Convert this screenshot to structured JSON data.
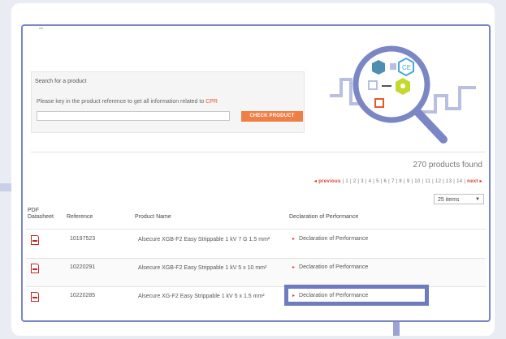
{
  "search": {
    "title": "Search for a product",
    "description": "Please key in the product reference to get all information related to",
    "description_link": "CPR",
    "input_value": "",
    "button_label": "CHECK PRODUCT"
  },
  "results": {
    "count_label": "270 products found",
    "pager": {
      "previous": "◂ previous",
      "pages": "| 1 | 2 | 3 | 4 | 5 | 6 | 7 | 8 | 9 | 10 | 11 | 12 | 13 | 14 |",
      "next": "next ▸"
    },
    "items_per_page": "25 items"
  },
  "table": {
    "headers": {
      "pdf": "PDF Datasheet",
      "reference": "Reference",
      "product_name": "Product Name",
      "dop": "Declaration of Performance"
    },
    "rows": [
      {
        "reference": "10197523",
        "product_name": "Alsecure XGB-F2 Easy Strippable 1 kV 7 G 1.5 mm²",
        "dop": "Declaration of Performance"
      },
      {
        "reference": "10220291",
        "product_name": "Alsecure XGB-F2 Easy Strippable 1 kV 5 x 10 mm²",
        "dop": "Declaration of Performance"
      },
      {
        "reference": "10220285",
        "product_name": "Alsecure XG-F2 Easy Strippable 1 kV 5 x 1.5 mm²",
        "dop": "Declaration of Performance"
      }
    ]
  },
  "colors": {
    "frame_border": "#7b86c4",
    "accent_orange": "#ef7f45",
    "link_red": "#d23c2a",
    "highlight": "#6e7bbf"
  }
}
